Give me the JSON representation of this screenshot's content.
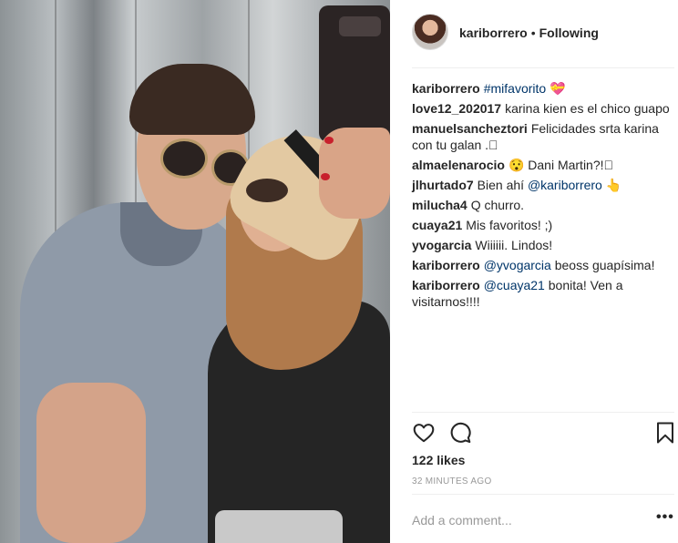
{
  "post": {
    "username": "kariborrero",
    "separator": "•",
    "follow_status": "Following"
  },
  "comments": [
    {
      "author": "kariborrero",
      "parts": [
        {
          "type": "link",
          "text": "#mifavorito"
        },
        {
          "type": "text",
          "text": " 💝"
        }
      ]
    },
    {
      "author": "love12_202017",
      "parts": [
        {
          "type": "text",
          "text": "karina kien es el chico guapo"
        }
      ]
    },
    {
      "author": "manuelsancheztori",
      "parts": [
        {
          "type": "text",
          "text": "Felicidades srta karina con tu galan .🏻"
        }
      ]
    },
    {
      "author": "almaelenarocio",
      "parts": [
        {
          "type": "text",
          "text": "😯 Dani Martin?!🏻"
        }
      ]
    },
    {
      "author": "jlhurtado7",
      "parts": [
        {
          "type": "text",
          "text": "Bien ahí "
        },
        {
          "type": "link",
          "text": "@kariborrero"
        },
        {
          "type": "text",
          "text": " 👆"
        }
      ]
    },
    {
      "author": "milucha4",
      "parts": [
        {
          "type": "text",
          "text": "Q churro."
        }
      ]
    },
    {
      "author": "cuaya21",
      "parts": [
        {
          "type": "text",
          "text": "Mis favoritos! ;)"
        }
      ]
    },
    {
      "author": "yvogarcia",
      "parts": [
        {
          "type": "text",
          "text": "Wiiiiii. Lindos!"
        }
      ]
    },
    {
      "author": "kariborrero",
      "parts": [
        {
          "type": "link",
          "text": "@yvogarcia"
        },
        {
          "type": "text",
          "text": " beoss guapísima!"
        }
      ]
    },
    {
      "author": "kariborrero",
      "parts": [
        {
          "type": "link",
          "text": "@cuaya21"
        },
        {
          "type": "text",
          "text": " bonita! Ven a visitarnos!!!!"
        }
      ]
    }
  ],
  "actions": {
    "like_icon": "heart-icon",
    "comment_icon": "comment-bubble-icon",
    "save_icon": "bookmark-icon"
  },
  "likes": "122 likes",
  "timestamp": "32 MINUTES AGO",
  "add_comment": {
    "placeholder": "Add a comment..."
  },
  "more_options": "•••",
  "colors": {
    "text": "#262626",
    "link": "#003569",
    "muted": "#999999",
    "divider": "#efefef"
  }
}
